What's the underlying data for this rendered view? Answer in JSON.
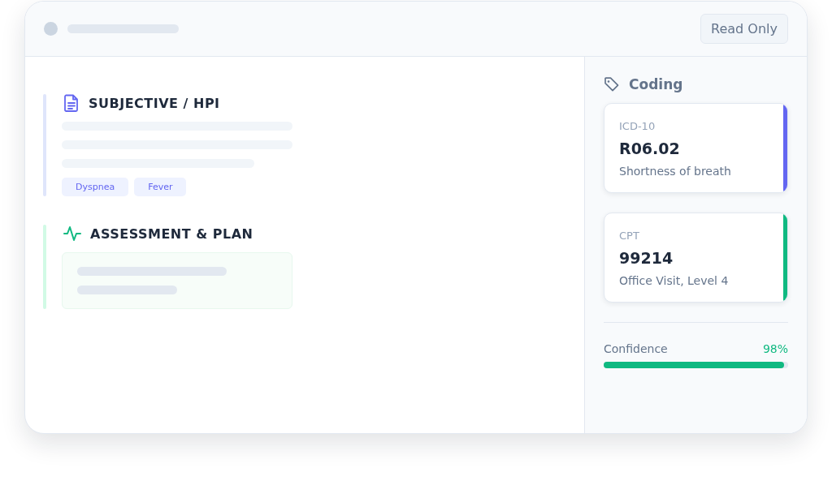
{
  "header": {
    "badge": "Read Only"
  },
  "sections": [
    {
      "kind": "notes",
      "title": "SUBJECTIVE / HPI",
      "color": "#dfe5fb",
      "tags": [
        "Dyspnea",
        "Fever"
      ]
    },
    {
      "kind": "plan",
      "title": "ASSESSMENT & PLAN",
      "color": "#d1fae5"
    }
  ],
  "coding": {
    "title": "Coding",
    "codes": [
      {
        "system": "ICD-10",
        "code": "R06.02",
        "description": "Shortness of breath",
        "color": "#6366f1"
      },
      {
        "system": "CPT",
        "code": "99214",
        "description": "Office Visit, Level 4",
        "color": "#10b981"
      }
    ],
    "confidence": {
      "label": "Confidence",
      "value": "98%",
      "level": 0.98
    }
  }
}
